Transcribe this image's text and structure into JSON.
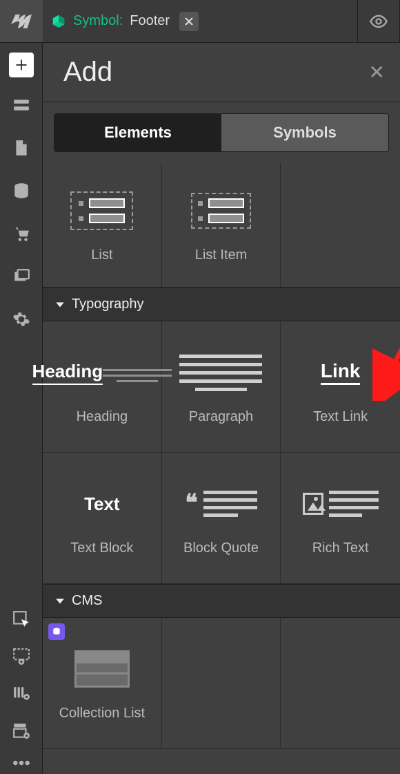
{
  "symbolbar": {
    "prefix": "Symbol:",
    "name": "Footer"
  },
  "panel": {
    "title": "Add"
  },
  "tabs": {
    "elements": "Elements",
    "symbols": "Symbols"
  },
  "row_basic": {
    "list": "List",
    "list_item": "List Item"
  },
  "sections": {
    "typography": "Typography",
    "cms": "CMS"
  },
  "typography": {
    "heading_word": "Heading",
    "heading": "Heading",
    "paragraph": "Paragraph",
    "link_word": "Link",
    "text_link": "Text Link",
    "text_word": "Text",
    "text_block": "Text Block",
    "block_quote": "Block Quote",
    "rich_text": "Rich Text"
  },
  "cms": {
    "collection_list": "Collection List"
  }
}
